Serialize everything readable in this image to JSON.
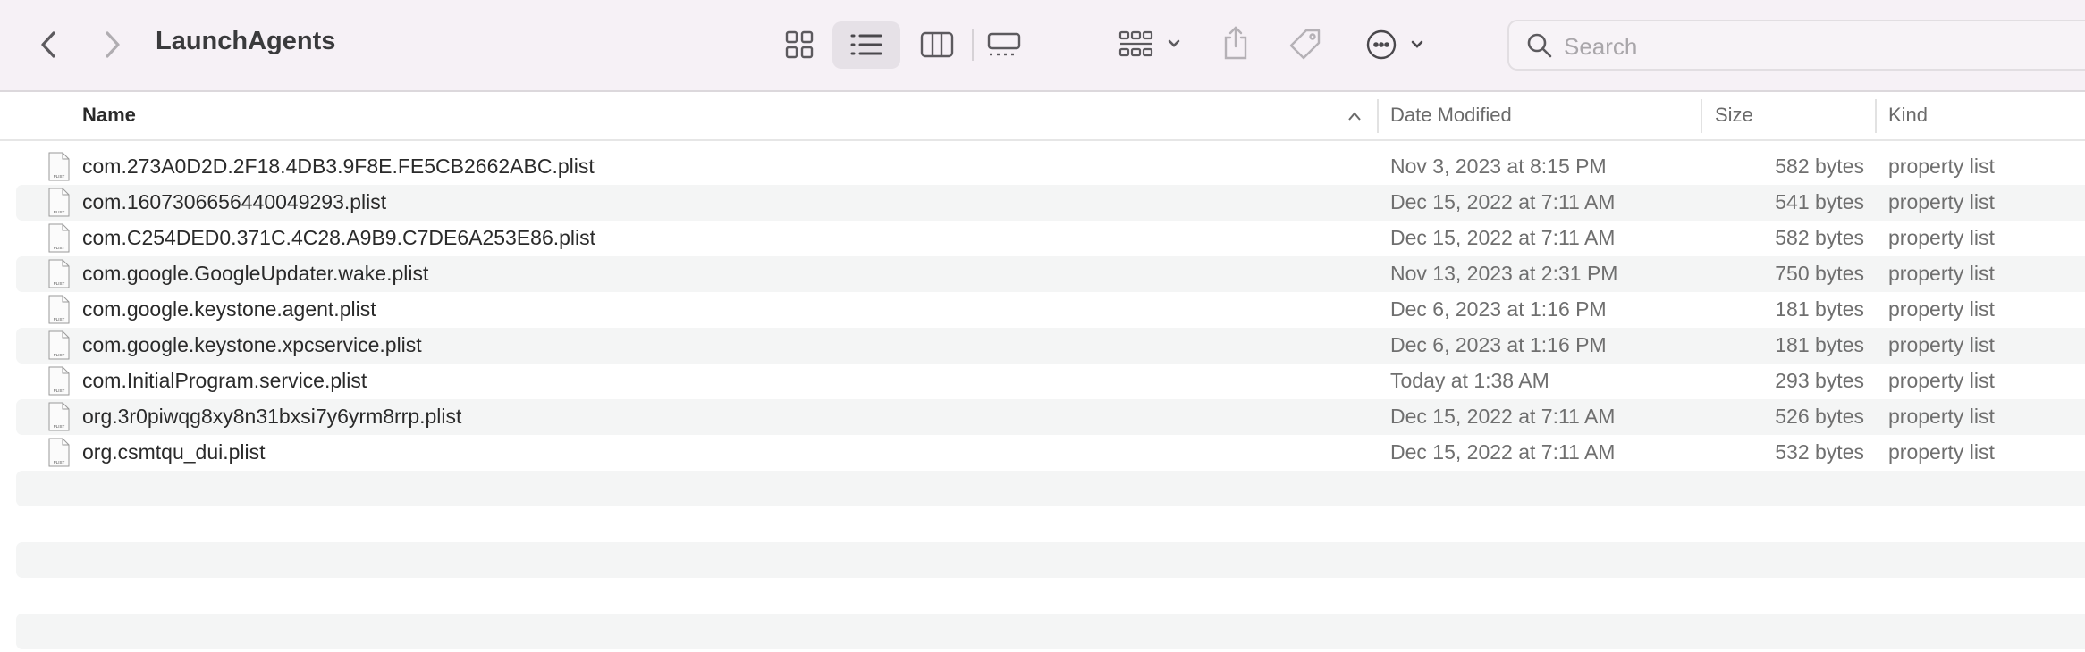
{
  "window": {
    "title": "LaunchAgents"
  },
  "toolbar": {
    "search_placeholder": "Search",
    "view_mode": "list"
  },
  "columns": {
    "name": "Name",
    "date": "Date Modified",
    "size": "Size",
    "kind": "Kind",
    "sort": "name-ascending"
  },
  "files": [
    {
      "name": "com.273A0D2D.2F18.4DB3.9F8E.FE5CB2662ABC.plist",
      "date": "Nov 3, 2023 at 8:15 PM",
      "size": "582 bytes",
      "kind": "property list"
    },
    {
      "name": "com.1607306656440049293.plist",
      "date": "Dec 15, 2022 at 7:11 AM",
      "size": "541 bytes",
      "kind": "property list"
    },
    {
      "name": "com.C254DED0.371C.4C28.A9B9.C7DE6A253E86.plist",
      "date": "Dec 15, 2022 at 7:11 AM",
      "size": "582 bytes",
      "kind": "property list"
    },
    {
      "name": "com.google.GoogleUpdater.wake.plist",
      "date": "Nov 13, 2023 at 2:31 PM",
      "size": "750 bytes",
      "kind": "property list"
    },
    {
      "name": "com.google.keystone.agent.plist",
      "date": "Dec 6, 2023 at 1:16 PM",
      "size": "181 bytes",
      "kind": "property list"
    },
    {
      "name": "com.google.keystone.xpcservice.plist",
      "date": "Dec 6, 2023 at 1:16 PM",
      "size": "181 bytes",
      "kind": "property list"
    },
    {
      "name": "com.InitialProgram.service.plist",
      "date": "Today at 1:38 AM",
      "size": "293 bytes",
      "kind": "property list"
    },
    {
      "name": "org.3r0piwqg8xy8n31bxsi7y6yrm8rrp.plist",
      "date": "Dec 15, 2022 at 7:11 AM",
      "size": "526 bytes",
      "kind": "property list"
    },
    {
      "name": "org.csmtqu_dui.plist",
      "date": "Dec 15, 2022 at 7:11 AM",
      "size": "532 bytes",
      "kind": "property list"
    }
  ],
  "icon_label": "PLIST"
}
